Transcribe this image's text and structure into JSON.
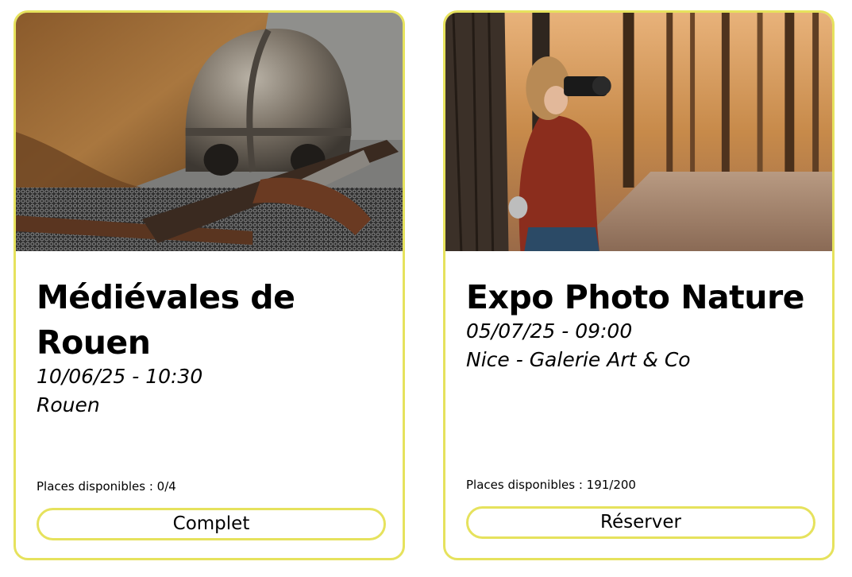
{
  "theme": {
    "accent": "#e6e25d"
  },
  "events": [
    {
      "image_icon": "medieval-helmet-photo",
      "title": "Médiévales de Rouen",
      "date": "10/06/25 - 10:30",
      "location": "Rouen",
      "seats_label": "Places disponibles : 0/4",
      "action_label": "Complet"
    },
    {
      "image_icon": "photographer-forest-photo",
      "title": "Expo Photo Nature",
      "date": "05/07/25 - 09:00",
      "location": "Nice - Galerie Art & Co",
      "seats_label": "Places disponibles : 191/200",
      "action_label": "Réserver"
    }
  ]
}
